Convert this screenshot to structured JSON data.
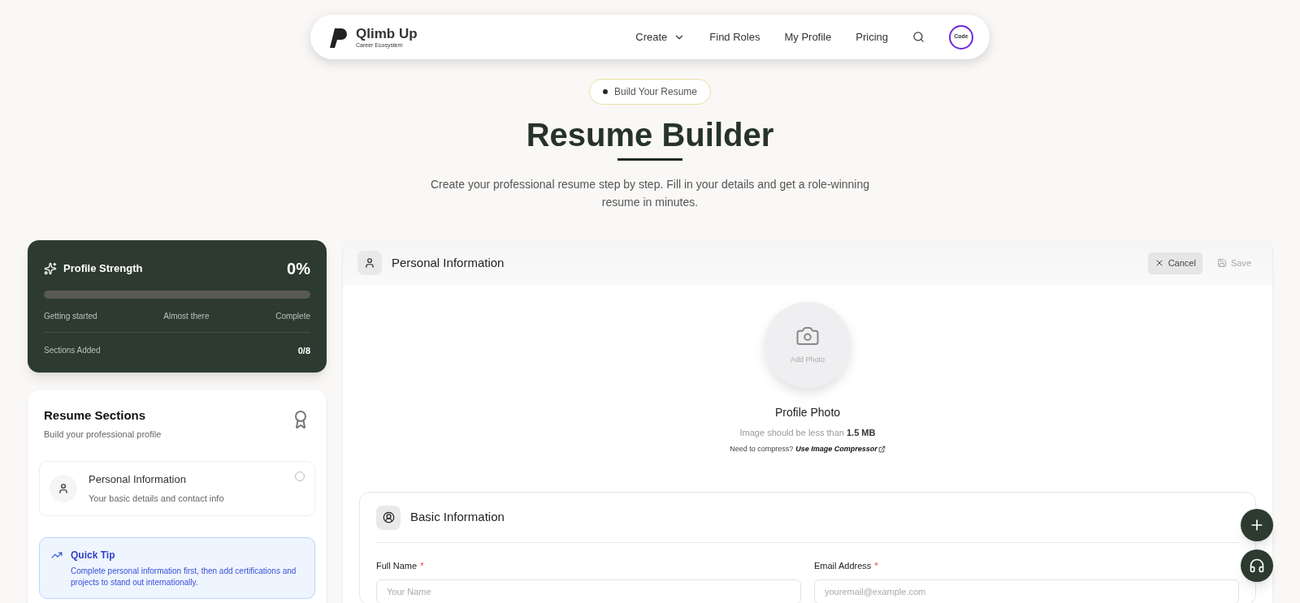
{
  "nav": {
    "brand": "Qlimb Up",
    "tagline": "Career Ecosystem",
    "items": [
      {
        "label": "Create",
        "dropdown": true
      },
      {
        "label": "Find Roles",
        "dropdown": false
      },
      {
        "label": "My Profile",
        "dropdown": false
      },
      {
        "label": "Pricing",
        "dropdown": false
      }
    ],
    "avatar_text": "Code"
  },
  "hero": {
    "badge": "Build Your Resume",
    "title": "Resume Builder",
    "subtitle": "Create your professional resume step by step. Fill in your details and get a role-winning resume in minutes."
  },
  "strength": {
    "title": "Profile Strength",
    "percent": "0%",
    "level": 0,
    "milestones": [
      "Getting started",
      "Almost there",
      "Complete"
    ],
    "sections_label": "Sections Added",
    "sections_count": "0/8"
  },
  "sections": {
    "title": "Resume Sections",
    "subtitle": "Build your professional profile",
    "items": [
      {
        "title": "Personal Information",
        "description": "Your basic details and contact info",
        "checked": false
      }
    ]
  },
  "tip": {
    "title": "Quick Tip",
    "text": "Complete personal information first, then add certifications and projects to stand out internationally."
  },
  "panel": {
    "title": "Personal Information",
    "cancel": "Cancel",
    "save": "Save",
    "save_disabled": true
  },
  "photo": {
    "add_label": "Add Photo",
    "title": "Profile Photo",
    "hint": "Image should be less than **1.5 MB**",
    "compress_prompt": "Need to compress?",
    "compress_link": "Use Image Compressor"
  },
  "basic": {
    "title": "Basic Information",
    "fields": [
      {
        "label": "Full Name",
        "required_mark": "*",
        "placeholder": "Your Name"
      },
      {
        "label": "Email Address",
        "required_mark": "*",
        "placeholder": "youremail@example.com"
      }
    ]
  }
}
